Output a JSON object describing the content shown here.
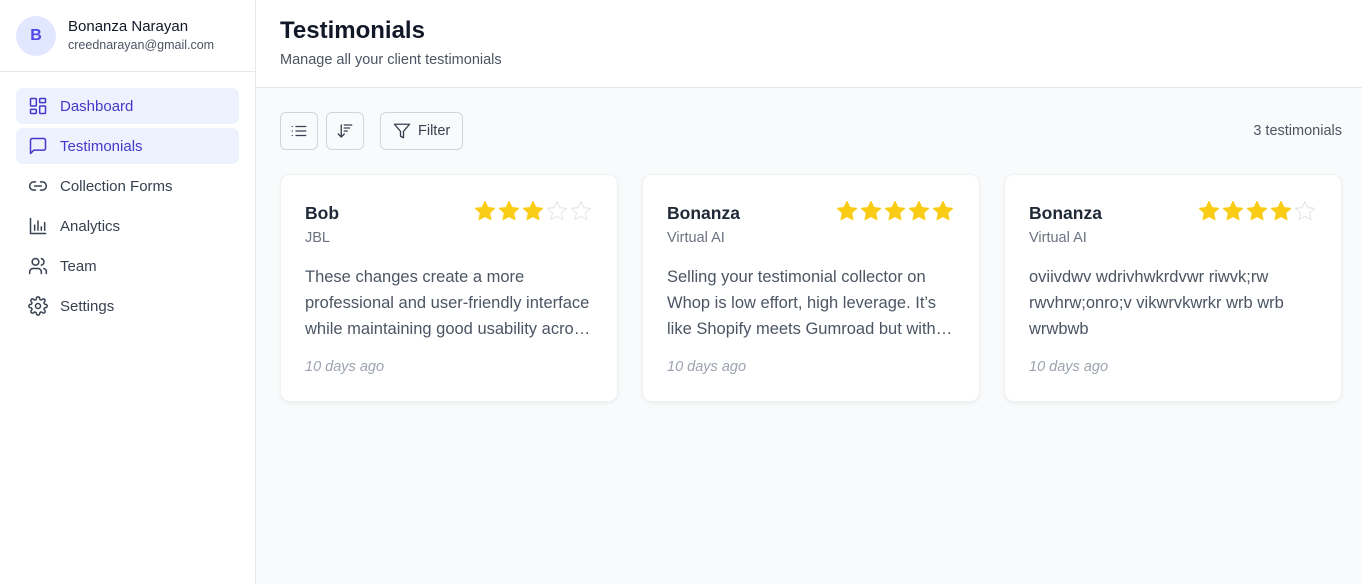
{
  "user": {
    "initial": "B",
    "name": "Bonanza Narayan",
    "email": "creednarayan@gmail.com"
  },
  "nav": [
    {
      "label": "Dashboard",
      "icon": "dashboard-icon",
      "active": true
    },
    {
      "label": "Testimonials",
      "icon": "message-square-icon",
      "active": true
    },
    {
      "label": "Collection Forms",
      "icon": "link-icon",
      "active": false
    },
    {
      "label": "Analytics",
      "icon": "bar-chart-icon",
      "active": false
    },
    {
      "label": "Team",
      "icon": "users-icon",
      "active": false
    },
    {
      "label": "Settings",
      "icon": "gear-icon",
      "active": false
    }
  ],
  "header": {
    "title": "Testimonials",
    "subtitle": "Manage all your client testimonials"
  },
  "toolbar": {
    "list_icon": "list-icon",
    "sort_icon": "sort-icon",
    "filter_label": "Filter",
    "filter_icon": "filter-icon",
    "count": "3 testimonials"
  },
  "colors": {
    "accent": "#4338ca",
    "accent_bg": "#eef2ff",
    "star_filled": "#facc15",
    "star_empty": "#e5e7eb"
  },
  "testimonials": [
    {
      "name": "Bob",
      "company": "JBL",
      "rating": 3,
      "text": "These changes create a more professional and user-friendly interface while maintaining good usability across the app.",
      "time": "10 days ago"
    },
    {
      "name": "Bonanza",
      "company": "Virtual AI",
      "rating": 5,
      "text": "Selling your testimonial collector on Whop is low effort, high leverage. It’s like Shopify meets Gumroad but without the hassle.",
      "time": "10 days ago"
    },
    {
      "name": "Bonanza",
      "company": "Virtual AI",
      "rating": 4,
      "text": "oviivdwv wdrivhwkrdvwr riwvk;rw rwvhrw;onro;v vikwrvkwrkr wrb wrb wrwbwb",
      "time": "10 days ago"
    }
  ]
}
